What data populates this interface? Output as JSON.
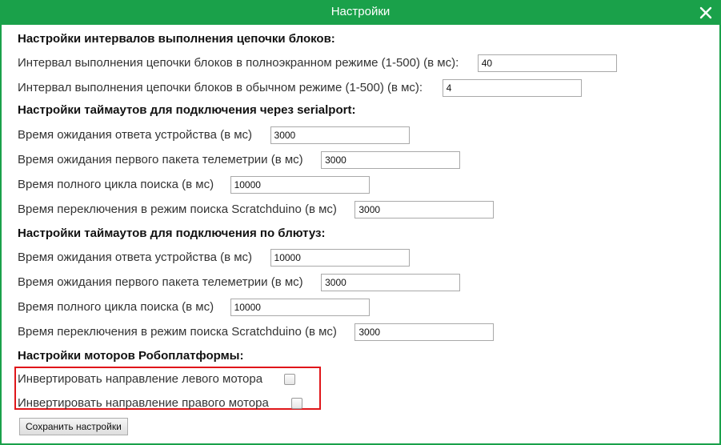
{
  "window": {
    "title": "Настройки"
  },
  "sections": {
    "intervals": {
      "title": "Настройки интервалов выполнения цепочки блоков:",
      "fullscreen_label": "Интервал выполнения цепочки блоков в полноэкранном режиме (1-500) (в мс):",
      "fullscreen_value": "40",
      "normal_label": "Интервал выполнения цепочки блоков в обычном режиме (1-500) (в мс):",
      "normal_value": "4"
    },
    "serial": {
      "title": "Настройки таймаутов для подключения через serialport:",
      "response_label": "Время ожидания ответа устройства (в мс)",
      "response_value": "3000",
      "telemetry_label": "Время ожидания первого пакета телеметрии (в мс)",
      "telemetry_value": "3000",
      "search_cycle_label": "Время полного цикла поиска (в мс)",
      "search_cycle_value": "10000",
      "switch_label": "Время переключения в режим поиска Scratchduino (в мс)",
      "switch_value": "3000"
    },
    "bluetooth": {
      "title": "Настройки таймаутов для подключения по блютуз:",
      "response_label": "Время ожидания ответа устройства (в мс)",
      "response_value": "10000",
      "telemetry_label": "Время ожидания первого пакета телеметрии (в мс)",
      "telemetry_value": "3000",
      "search_cycle_label": "Время полного цикла поиска (в мс)",
      "search_cycle_value": "10000",
      "switch_label": "Время переключения в режим поиска Scratchduino (в мс)",
      "switch_value": "3000"
    },
    "motors": {
      "title": "Настройки моторов Робоплатформы:",
      "invert_left_label": "Инвертировать направление левого мотора",
      "invert_left_checked": false,
      "invert_right_label": "Инвертировать направление правого мотора",
      "invert_right_checked": false
    }
  },
  "buttons": {
    "save_label": "Сохранить настройки"
  },
  "icons": {
    "close": "close-icon"
  },
  "colors": {
    "titlebar": "#1aa14a",
    "highlight": "#e0161a"
  }
}
